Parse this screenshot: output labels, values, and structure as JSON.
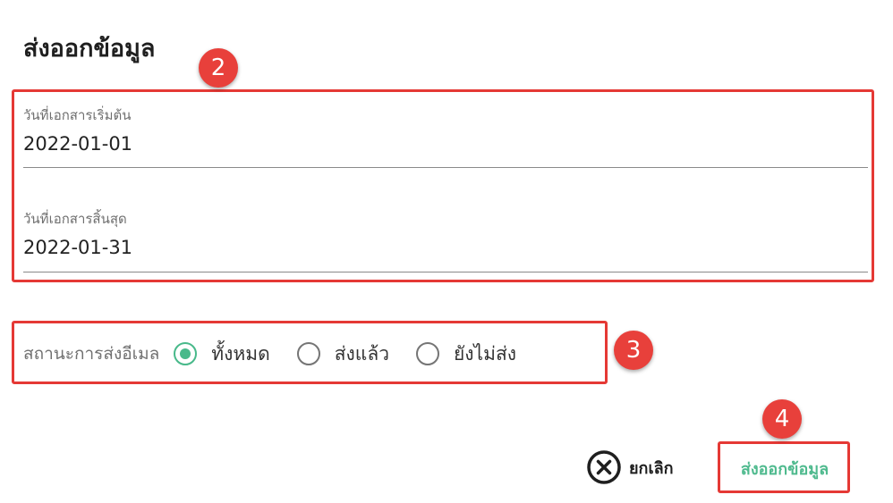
{
  "dialog": {
    "title": "ส่งออกข้อมูล"
  },
  "date_range": {
    "start": {
      "label": "วันที่เอกสารเริ่มต้น",
      "value": "2022-01-01"
    },
    "end": {
      "label": "วันที่เอกสารสิ้นสุด",
      "value": "2022-01-31"
    }
  },
  "email_status": {
    "label": "สถานะการส่งอีเมล",
    "selected": "all",
    "options": [
      {
        "label": "ทั้งหมด",
        "checked": true
      },
      {
        "label": "ส่งแล้ว",
        "checked": false
      },
      {
        "label": "ยังไม่ส่ง",
        "checked": false
      }
    ]
  },
  "actions": {
    "cancel_label": "ยกเลิก",
    "export_label": "ส่งออกข้อมูล"
  },
  "annotations": {
    "marker_2": "2",
    "marker_3": "3",
    "marker_4": "4"
  },
  "colors": {
    "accent": "#4fba8e",
    "highlight": "#e53935",
    "marker": "#e8403b"
  },
  "icons": {
    "cancel": "close-circle-icon"
  }
}
